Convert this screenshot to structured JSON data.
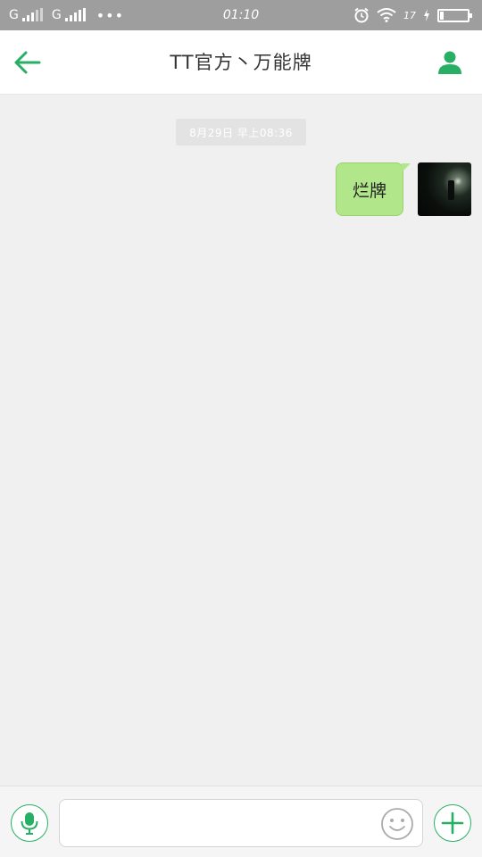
{
  "status_bar": {
    "network1": "G",
    "network2": "G",
    "dots": "•••",
    "time": "01:10",
    "battery_label": "17"
  },
  "header": {
    "title": "TT官方丶万能牌",
    "back_icon": "arrow-left-icon",
    "profile_icon": "person-icon"
  },
  "chat": {
    "timestamp": "8月29日 早上08:36",
    "messages": [
      {
        "sender": "me",
        "text": "烂牌"
      }
    ]
  },
  "input_bar": {
    "placeholder": "",
    "value": "",
    "mic_icon": "microphone-icon",
    "emoji_icon": "smiley-icon",
    "plus_icon": "plus-icon"
  },
  "colors": {
    "accent": "#27b065",
    "bubble": "#b2e68a",
    "status_bar_bg": "#9e9e9e",
    "chat_bg": "#f0f0f0"
  }
}
